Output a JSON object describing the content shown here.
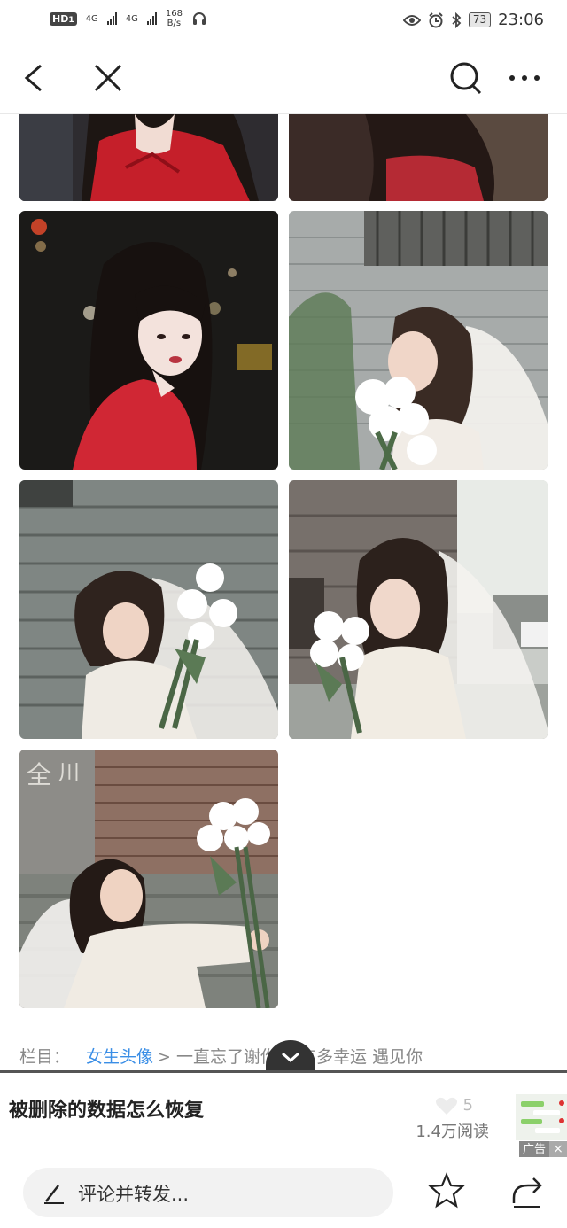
{
  "status_bar": {
    "hd": "HD",
    "hd_sub": "1",
    "net1": "4G",
    "net2": "4G",
    "speed": "168",
    "speed_unit": "B/s",
    "battery": "73",
    "time": "23:06",
    "icons": [
      "headset-icon",
      "eye-icon",
      "alarm-icon",
      "bluetooth-icon"
    ]
  },
  "nav": {
    "icons": [
      "back-arrow-icon",
      "close-icon",
      "search-icon",
      "more-dots-icon"
    ]
  },
  "photos": [
    {
      "id": "red-dress-top-left",
      "palette": {
        "bg": "#2a2a2e",
        "main": "#c51f2a",
        "skin": "#f1dcd3",
        "hair": "#1d1613"
      }
    },
    {
      "id": "red-dress-top-right",
      "palette": {
        "bg": "#3a2a28",
        "main": "#b52a34",
        "skin": "#ead1c7",
        "hair": "#241815"
      }
    },
    {
      "id": "girl-red-night",
      "palette": {
        "bg": "#1b1a18",
        "main": "#d02734",
        "skin": "#f3e2dc",
        "hair": "#17110f"
      }
    },
    {
      "id": "girl-veil-flowers-1",
      "palette": {
        "bg": "#a9adac",
        "main": "#f4f2ef",
        "skin": "#f0d6c8",
        "hair": "#3a2b24"
      }
    },
    {
      "id": "girl-veil-flowers-2",
      "palette": {
        "bg": "#7d8480",
        "main": "#efebe4",
        "skin": "#efd4c5",
        "hair": "#2f231e"
      }
    },
    {
      "id": "girl-veil-street",
      "palette": {
        "bg": "#9a9d99",
        "main": "#f1ece3",
        "skin": "#f0d8cb",
        "hair": "#2c211c"
      }
    },
    {
      "id": "girl-veil-sitting",
      "palette": {
        "bg": "#8c6e60",
        "main": "#f0ebe3",
        "skin": "#efd3c2",
        "hair": "#241a16"
      }
    }
  ],
  "category": {
    "label": "栏目：",
    "link": "女生头像",
    "rest": "> 一直忘了谢你 我有多幸运 遇见你"
  },
  "ad": {
    "title": "被删除的数据怎么恢复",
    "likes": "5",
    "reads": "1.4万阅读",
    "tag": "广告",
    "close": "×"
  },
  "bottom": {
    "comment_placeholder": "评论并转发...",
    "icons": [
      "pen-icon",
      "star-icon",
      "share-icon"
    ]
  }
}
